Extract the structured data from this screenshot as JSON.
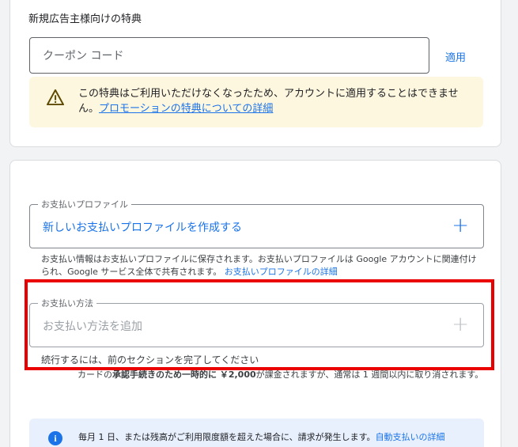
{
  "coupon_section": {
    "title": "新規広告主様向けの特典",
    "coupon_placeholder": "クーポン コード",
    "apply_label": "適用",
    "warning_text": "この特典はご利用いただけなくなったため、アカウントに適用することはできません。",
    "warning_link": "プロモーションの特典についての詳細",
    "warning_icon": "warning-triangle-icon",
    "warning_color": "#fef7e0"
  },
  "payment_section": {
    "profile_legend": "お支払いプロファイル",
    "profile_value": "新しいお支払いプロファイルを作成する",
    "profile_note": "お支払い情報はお支払いプロファイルに保存されます。お支払いプロファイルは Google アカウントに関連付けられ、Google サービス全体で共有されます。",
    "profile_note_link": "お支払いプロファイルの詳細",
    "method_legend": "お支払い方法",
    "method_placeholder": "お支払い方法を追加",
    "method_note": "続行するには、前のセクションを完了してください",
    "card_note_prefix": "カードの",
    "card_note_bold": "承認手続きのため一時的に ￥2,000",
    "card_note_suffix": "が課金されますが、通常は 1 週間以内に取り消されます。",
    "info_text": "毎月 1 日、または残高がご利用限度額を超えた場合に、請求が発生します。",
    "info_link": "自動支払いの詳細",
    "info_icon": "info-icon"
  },
  "colors": {
    "accent": "#1a73e8",
    "highlight": "#ea0000",
    "warning_bg": "#fef7e0",
    "info_bg": "#e8f0fe"
  }
}
